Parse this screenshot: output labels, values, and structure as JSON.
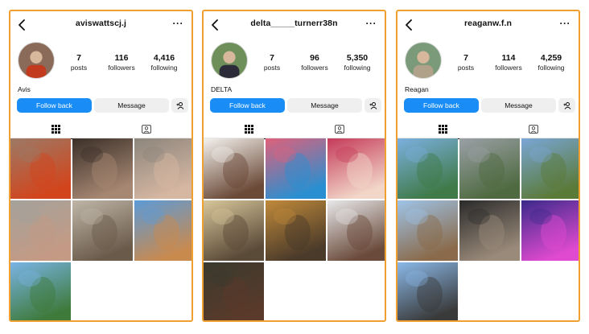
{
  "profiles": [
    {
      "username": "aviswattscj.j",
      "display_name": "Avis",
      "stats": {
        "posts": "7",
        "posts_label": "posts",
        "followers": "116",
        "followers_label": "followers",
        "following": "4,416",
        "following_label": "following"
      },
      "buttons": {
        "follow": "Follow back",
        "message": "Message"
      },
      "avatar_colors": [
        "#8a6a58",
        "#c23b1e"
      ],
      "photos": [
        {
          "icon": "photo-orange-top",
          "colors": [
            "#9c7a66",
            "#d2451c"
          ]
        },
        {
          "icon": "photo-mirror-selfie",
          "colors": [
            "#3a2f28",
            "#a68772"
          ]
        },
        {
          "icon": "photo-hand-rings",
          "colors": [
            "#8c857c",
            "#d6b7a2"
          ]
        },
        {
          "icon": "photo-hand-ring",
          "colors": [
            "#a4a29c",
            "#c49a84"
          ]
        },
        {
          "icon": "photo-mirror-room",
          "colors": [
            "#bfb6a8",
            "#6a5a4a"
          ]
        },
        {
          "icon": "photo-building",
          "colors": [
            "#5b9ad8",
            "#c98a4e"
          ]
        },
        {
          "icon": "photo-garden-pond",
          "colors": [
            "#79b4e6",
            "#3e7a3a"
          ]
        }
      ]
    },
    {
      "username": "delta_____turnerr38n",
      "display_name": "DELTA",
      "stats": {
        "posts": "7",
        "posts_label": "posts",
        "followers": "96",
        "followers_label": "followers",
        "following": "5,350",
        "following_label": "following"
      },
      "buttons": {
        "follow": "Follow back",
        "message": "Message"
      },
      "avatar_colors": [
        "#6f8f5a",
        "#2b2b3a"
      ],
      "photos": [
        {
          "icon": "photo-portrait-white",
          "colors": [
            "#f4f2ee",
            "#6b4a38"
          ]
        },
        {
          "icon": "photo-graffiti-wall",
          "colors": [
            "#e0607a",
            "#2a8fd0"
          ]
        },
        {
          "icon": "photo-group-selfie",
          "colors": [
            "#c53a5a",
            "#f2d7c8"
          ]
        },
        {
          "icon": "photo-sunlit-portrait",
          "colors": [
            "#d8c69a",
            "#5a4a38"
          ]
        },
        {
          "icon": "photo-autumn-sitting",
          "colors": [
            "#c08a3a",
            "#4a3a2a"
          ]
        },
        {
          "icon": "photo-portrait-light",
          "colors": [
            "#e8e8ea",
            "#6a4a3a"
          ]
        },
        {
          "icon": "photo-portrait-dark",
          "colors": [
            "#3a3a2e",
            "#5a3a2a"
          ]
        }
      ]
    },
    {
      "username": "reaganw.f.n",
      "display_name": "Reagan",
      "stats": {
        "posts": "7",
        "posts_label": "posts",
        "followers": "114",
        "followers_label": "followers",
        "following": "4,259",
        "following_label": "following"
      },
      "buttons": {
        "follow": "Follow back",
        "message": "Message"
      },
      "avatar_colors": [
        "#7a9a7a",
        "#b0a28a"
      ],
      "photos": [
        {
          "icon": "photo-river-valley",
          "colors": [
            "#7cb0e0",
            "#3f7a48"
          ]
        },
        {
          "icon": "photo-old-town",
          "colors": [
            "#9aa0a6",
            "#4f6a40"
          ]
        },
        {
          "icon": "photo-vineyard",
          "colors": [
            "#7aa6d6",
            "#5a7a38"
          ]
        },
        {
          "icon": "photo-street-houses",
          "colors": [
            "#9ec4e8",
            "#8a6a4a"
          ]
        },
        {
          "icon": "photo-mirror-selfie-dark",
          "colors": [
            "#2a2a2a",
            "#9a8a7a"
          ]
        },
        {
          "icon": "photo-neon-selfie",
          "colors": [
            "#3a2a8a",
            "#e04ad0"
          ]
        },
        {
          "icon": "photo-bridge-man",
          "colors": [
            "#8ab8e8",
            "#3a3a3a"
          ]
        }
      ]
    }
  ]
}
